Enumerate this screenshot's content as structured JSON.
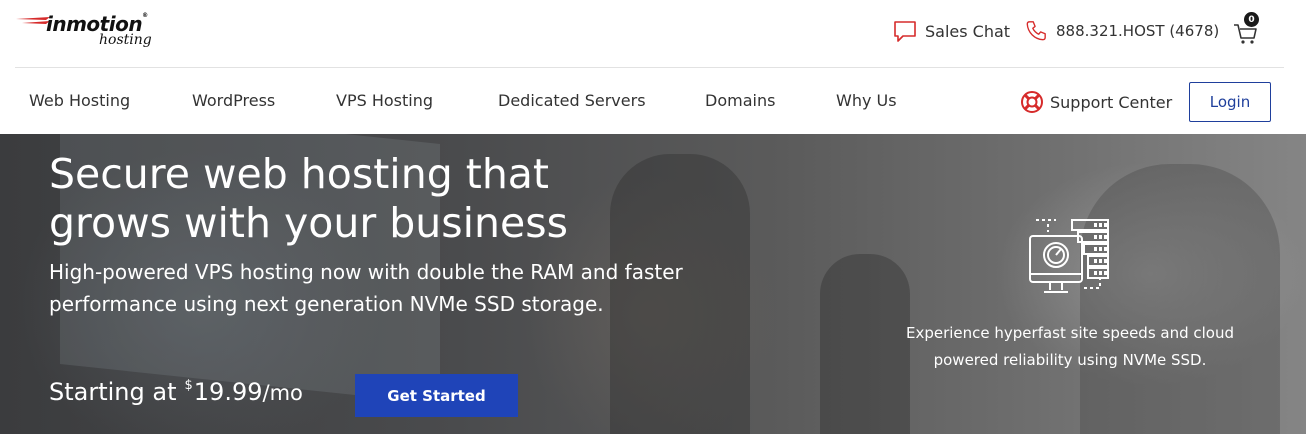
{
  "header": {
    "logo_brand": "inmotion",
    "logo_reg": "®",
    "logo_sub": "hosting",
    "sales_chat": "Sales Chat",
    "phone": "888.321.HOST (4678)",
    "cart_count": "0"
  },
  "nav": {
    "items": [
      "Web Hosting",
      "WordPress",
      "VPS Hosting",
      "Dedicated Servers",
      "Domains",
      "Why Us"
    ],
    "support": "Support Center",
    "login": "Login"
  },
  "hero": {
    "title_line1": "Secure web hosting that",
    "title_line2": "grows with your business",
    "subtitle": "High-powered VPS hosting now with double the RAM and faster performance using next generation NVMe SSD storage.",
    "price_prefix": "Starting at",
    "price_currency": "$",
    "price_amount": "19.99",
    "price_suffix": "/mo",
    "cta": "Get Started",
    "note_line1": "Experience hyperfast site speeds and cloud",
    "note_line2": "powered reliability using NVMe SSD."
  },
  "icons": {
    "chat": "chat-bubble-icon",
    "phone": "phone-icon",
    "cart": "cart-icon",
    "support": "lifebuoy-icon",
    "hero": "server-speedometer-icon"
  },
  "colors": {
    "accent_red": "#d62b2b",
    "primary_blue": "#1f44b8",
    "login_blue": "#1f3f9c"
  }
}
